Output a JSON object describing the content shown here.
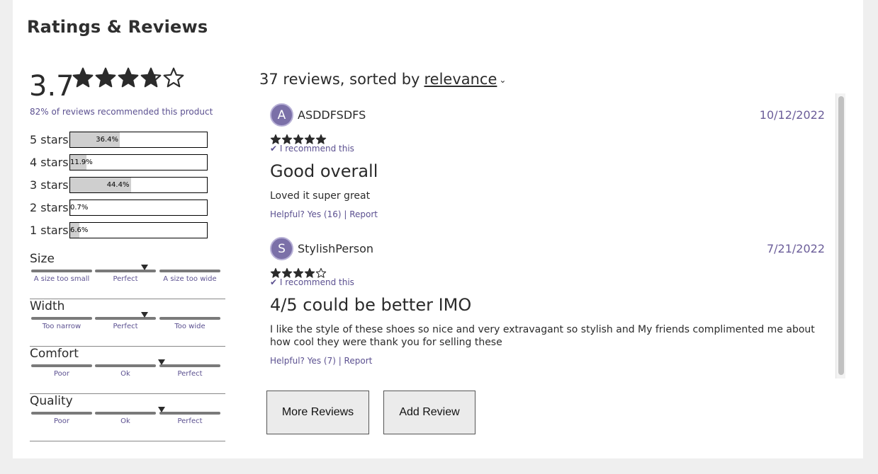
{
  "section_title": "Ratings & Reviews",
  "summary": {
    "average": "3.7",
    "average_stars": 3.7,
    "recommend_text": "82% of reviews recommended this product"
  },
  "breakdown": [
    {
      "label": "5 stars",
      "pct_text": "36.4%",
      "pct": 36.4
    },
    {
      "label": "4 stars",
      "pct_text": "11.9%",
      "pct": 11.9
    },
    {
      "label": "3 stars",
      "pct_text": "44.4%",
      "pct": 44.4
    },
    {
      "label": "2 stars",
      "pct_text": "0.7%",
      "pct": 0.7
    },
    {
      "label": "1 stars",
      "pct_text": "6.6%",
      "pct": 6.6
    }
  ],
  "characteristics": [
    {
      "name": "Size",
      "labels": [
        "A size too small",
        "Perfect",
        "A size too wide"
      ],
      "value_fraction": 0.6
    },
    {
      "name": "Width",
      "labels": [
        "Too narrow",
        "Perfect",
        "Too wide"
      ],
      "value_fraction": 0.6
    },
    {
      "name": "Comfort",
      "labels": [
        "Poor",
        "Ok",
        "Perfect"
      ],
      "value_fraction": 0.69
    },
    {
      "name": "Quality",
      "labels": [
        "Poor",
        "Ok",
        "Perfect"
      ],
      "value_fraction": 0.69
    }
  ],
  "reviews_header": {
    "prefix": "37 reviews, sorted by",
    "sort": "relevance",
    "caret": "⌄"
  },
  "reviews": [
    {
      "initial": "A",
      "user": "ASDDFSDFS",
      "date": "10/12/2022",
      "rating": 5,
      "recommend": "✔ I recommend this",
      "title": "Good overall",
      "body": "Loved it super great",
      "helpful": "Helpful? Yes (16) | Report"
    },
    {
      "initial": "S",
      "user": "StylishPerson",
      "date": "7/21/2022",
      "rating": 4,
      "recommend": "✔ I recommend this",
      "title": "4/5 could be better IMO",
      "body": "I like the style of these shoes so nice and very extravagant so stylish and My friends complimented me about how cool they were thank you for selling these",
      "helpful": "Helpful? Yes (7) | Report"
    }
  ],
  "buttons": {
    "more": "More Reviews",
    "add": "Add Review"
  },
  "colors": {
    "accent": "#5b5090",
    "avatar": "#7b70a8",
    "bar_fill": "#cfcfcf"
  }
}
